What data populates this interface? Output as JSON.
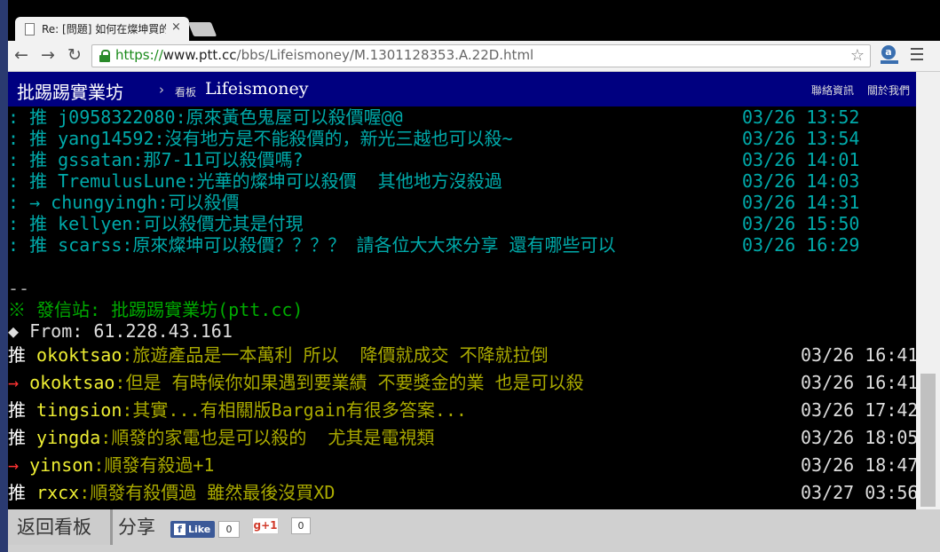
{
  "browser": {
    "tab_title": "Re: [問題] 如何在燦坤買的",
    "tab_close": "×",
    "url_scheme": "https://",
    "url_host": "www.ptt.cc",
    "url_path": "/bbs/Lifeismoney/M.1301128353.A.22D.html",
    "ext_letter": "a"
  },
  "header": {
    "site_title": "批踢踢實業坊",
    "separator": "›",
    "board_label": "看板",
    "board_name": "Lifeismoney",
    "contact_link": "聯絡資訊",
    "about_link": "關於我們"
  },
  "quoted_pushes": [
    {
      "text": ": 推 j0958322080:原來黃色鬼屋可以殺價喔@@",
      "time": "03/26 13:52"
    },
    {
      "text": ": 推 yang14592:沒有地方是不能殺價的，新光三越也可以殺~",
      "time": "03/26 13:54"
    },
    {
      "text": ": 推 gssatan:那7-11可以殺價嗎?",
      "time": "03/26 14:01"
    },
    {
      "text": ": 推 TremulusLune:光華的燦坤可以殺價  其他地方沒殺過",
      "time": "03/26 14:03"
    },
    {
      "text": ": → chungyingh:可以殺價",
      "time": "03/26 14:31"
    },
    {
      "text": ": 推 kellyen:可以殺價尤其是付現",
      "time": "03/26 15:50"
    },
    {
      "text": ": 推 scarss:原來燦坤可以殺價？？？？ 請各位大大來分享 還有哪些可以",
      "time": "03/26 16:29"
    }
  ],
  "signature": {
    "dash": "--",
    "origin": "※ 發信站: 批踢踢實業坊(ptt.cc)",
    "from": "◆ From: 61.228.43.161"
  },
  "pushes": [
    {
      "tag": "推",
      "type": "push",
      "user": "okoktsao",
      "content": ":旅遊產品是一本萬利 所以  降價就成交 不降就拉倒",
      "time": "03/26 16:41"
    },
    {
      "tag": "→",
      "type": "arrow",
      "user": "okoktsao",
      "content": ":但是 有時候你如果遇到要業績 不要獎金的業 也是可以殺",
      "time": "03/26 16:41"
    },
    {
      "tag": "推",
      "type": "push",
      "user": "tingsion",
      "content": ":其實...有相關版Bargain有很多答案...",
      "time": "03/26 17:42"
    },
    {
      "tag": "推",
      "type": "push",
      "user": "yingda",
      "content": ":順發的家電也是可以殺的  尤其是電視類",
      "time": "03/26 18:05"
    },
    {
      "tag": "→",
      "type": "arrow",
      "user": "yinson",
      "content": ":順發有殺過+1",
      "time": "03/26 18:47"
    },
    {
      "tag": "推",
      "type": "push",
      "user": "rxcx",
      "content": ":順發有殺價過 雖然最後沒買XD",
      "time": "03/27 03:56"
    }
  ],
  "footer": {
    "back_label": "返回看板",
    "share_label": "分享",
    "fb_like_label": "Like",
    "fb_count": "0",
    "gplus_label": "g+1",
    "gplus_count": "0"
  }
}
